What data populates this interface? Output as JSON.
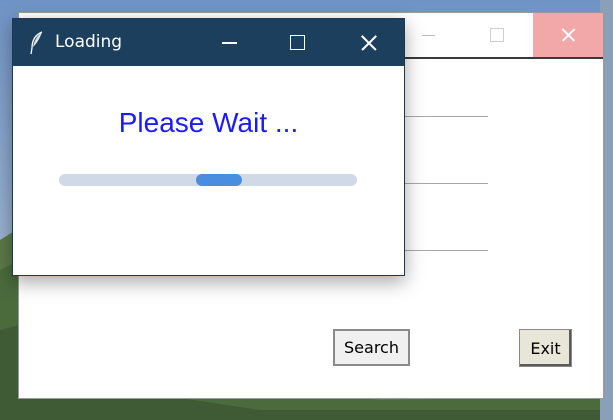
{
  "loading_dialog": {
    "title": "Loading",
    "message": "Please Wait ...",
    "progress": 0.5
  },
  "back_window": {
    "search_label": "Search",
    "exit_label": "Exit",
    "entry_fields": [
      "",
      "",
      ""
    ]
  },
  "colors": {
    "dialog_titlebar": "#1b3f5c",
    "message_text": "#1a1aff",
    "progress_track": "#d0dae6",
    "progress_fill": "#4a8ee0",
    "back_close_hover": "#f2a8a8"
  },
  "icons": {
    "dialog_app_icon": "feather-icon",
    "window_buttons": [
      "minimize-icon",
      "maximize-icon",
      "close-icon"
    ]
  }
}
